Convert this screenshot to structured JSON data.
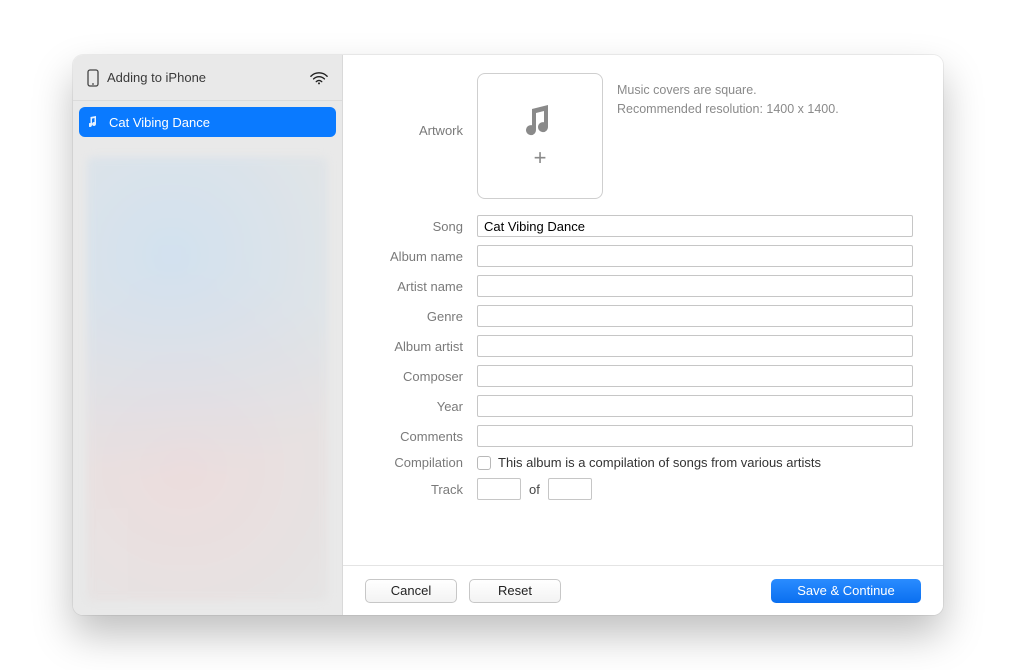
{
  "sidebar": {
    "device_label": "Adding to iPhone",
    "items": [
      {
        "label": "Cat Vibing Dance",
        "selected": true
      }
    ]
  },
  "artwork": {
    "label": "Artwork",
    "hint_line1": "Music covers are square.",
    "hint_line2": "Recommended resolution: 1400 x 1400."
  },
  "form": {
    "song": {
      "label": "Song",
      "value": "Cat Vibing Dance"
    },
    "album_name": {
      "label": "Album name",
      "value": ""
    },
    "artist_name": {
      "label": "Artist name",
      "value": ""
    },
    "genre": {
      "label": "Genre",
      "value": ""
    },
    "album_artist": {
      "label": "Album artist",
      "value": ""
    },
    "composer": {
      "label": "Composer",
      "value": ""
    },
    "year": {
      "label": "Year",
      "value": ""
    },
    "comments": {
      "label": "Comments",
      "value": ""
    },
    "compilation": {
      "label": "Compilation",
      "checkbox_label": "This album is a compilation of songs from various artists",
      "checked": false
    },
    "track": {
      "label": "Track",
      "num": "",
      "of_label": "of",
      "total": ""
    }
  },
  "footer": {
    "cancel": "Cancel",
    "reset": "Reset",
    "save": "Save & Continue"
  }
}
